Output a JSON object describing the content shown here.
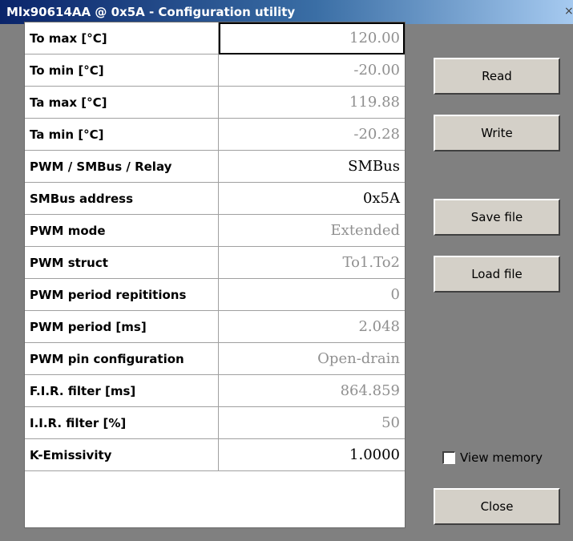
{
  "window": {
    "title": "Mlx90614AA @ 0x5A - Configuration utility",
    "close_glyph": "×"
  },
  "rows": [
    {
      "label": "To max [°C]",
      "value": "120.00",
      "style": "dim",
      "selected": true
    },
    {
      "label": "To min [°C]",
      "value": "-20.00",
      "style": "dim"
    },
    {
      "label": "Ta max [°C]",
      "value": "119.88",
      "style": "dim"
    },
    {
      "label": "Ta min [°C]",
      "value": "-20.28",
      "style": "dim"
    },
    {
      "label": "PWM / SMBus / Relay",
      "value": "SMBus",
      "style": "dark"
    },
    {
      "label": "SMBus address",
      "value": "0x5A",
      "style": "dark"
    },
    {
      "label": "PWM mode",
      "value": "Extended",
      "style": "dim"
    },
    {
      "label": "PWM struct",
      "value": "To1.To2",
      "style": "dim"
    },
    {
      "label": "PWM period repititions",
      "value": "0",
      "style": "dim"
    },
    {
      "label": "PWM period [ms]",
      "value": "2.048",
      "style": "dim"
    },
    {
      "label": "PWM pin configuration",
      "value": "Open-drain",
      "style": "dim"
    },
    {
      "label": "F.I.R. filter [ms]",
      "value": "864.859",
      "style": "dim"
    },
    {
      "label": "I.I.R. filter [%]",
      "value": "50",
      "style": "dim"
    },
    {
      "label": "K-Emissivity",
      "value": "1.0000",
      "style": "dark"
    }
  ],
  "buttons": {
    "read": "Read",
    "write": "Write",
    "save_file": "Save file",
    "load_file": "Load file",
    "close": "Close"
  },
  "view_memory": {
    "label": "View memory",
    "checked": false
  }
}
